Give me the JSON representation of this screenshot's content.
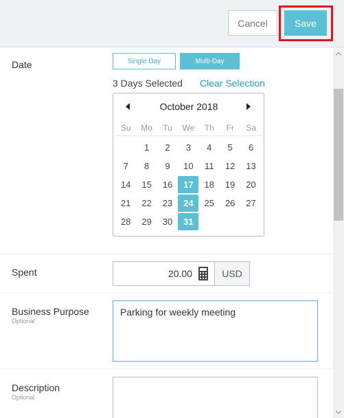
{
  "header": {
    "cancel_label": "Cancel",
    "save_label": "Save",
    "highlight_color": "#e0141e",
    "accent_color": "#5bc0d3"
  },
  "date": {
    "label": "Date",
    "single_day_label": "Single Day",
    "multi_day_label": "Multi-Day",
    "active_mode": "Multi-Day",
    "days_selected": "3 Days Selected",
    "clear_selection": "Clear Selection"
  },
  "calendar": {
    "month_title": "October 2018",
    "weekdays": [
      "Su",
      "Mo",
      "Tu",
      "We",
      "Th",
      "Fr",
      "Sa"
    ],
    "weeks": [
      [
        "",
        "1",
        "2",
        "3",
        "4",
        "5",
        "6"
      ],
      [
        "7",
        "8",
        "9",
        "10",
        "11",
        "12",
        "13"
      ],
      [
        "14",
        "15",
        "16",
        "17",
        "18",
        "19",
        "20"
      ],
      [
        "21",
        "22",
        "23",
        "24",
        "25",
        "26",
        "27"
      ],
      [
        "28",
        "29",
        "30",
        "31",
        "",
        "",
        ""
      ]
    ],
    "selected_days": [
      "17",
      "24",
      "31"
    ],
    "prev_icon": "caret-left-icon",
    "next_icon": "caret-right-icon"
  },
  "spent": {
    "label": "Spent",
    "value": "20.00",
    "currency": "USD",
    "icon": "calculator-icon"
  },
  "business_purpose": {
    "label": "Business Purpose",
    "optional_label": "Optional",
    "value": "Parking for weekly meeting"
  },
  "description": {
    "label": "Description",
    "optional_label": "Optional",
    "value": ""
  }
}
